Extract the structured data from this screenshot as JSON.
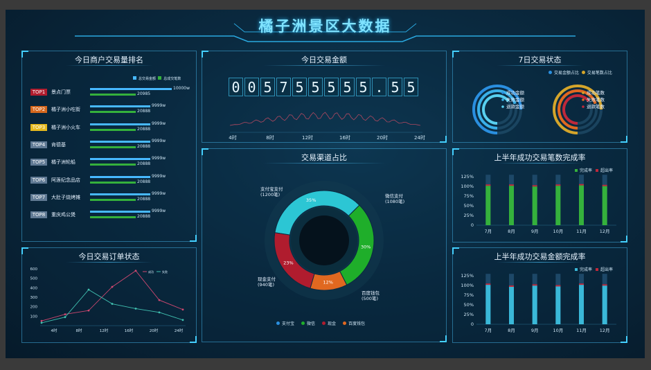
{
  "title": "橘子洲景区大数据",
  "colors": {
    "accent": "#44d0ff",
    "green": "#35b13c",
    "blue": "#47b9ff",
    "red": "#c0283a",
    "orange": "#e06820",
    "teal": "#2cc6d4"
  },
  "rank_panel": {
    "title": "今日商户交易量排名",
    "legend": [
      "总交易金额",
      "总成交笔数"
    ],
    "rows": [
      {
        "badge": "TOP1",
        "name": "景点门票",
        "v1": "10000w",
        "v2": "20985",
        "color": "#b01c2e",
        "f1": 1.0,
        "f2": 0.56
      },
      {
        "badge": "TOP2",
        "name": "橘子洲小吃街",
        "v1": "9999w",
        "v2": "20888",
        "color": "#d5671d",
        "f1": 0.74,
        "f2": 0.56
      },
      {
        "badge": "TOP3",
        "name": "橘子洲小火车",
        "v1": "9999w",
        "v2": "20888",
        "color": "#e6b91e",
        "f1": 0.74,
        "f2": 0.56
      },
      {
        "badge": "TOP4",
        "name": "肯德基",
        "v1": "9999w",
        "v2": "20888",
        "color": "#607a94",
        "f1": 0.74,
        "f2": 0.56
      },
      {
        "badge": "TOP5",
        "name": "橘子洲轮船",
        "v1": "9999w",
        "v2": "20888",
        "color": "#607a94",
        "f1": 0.74,
        "f2": 0.56
      },
      {
        "badge": "TOP6",
        "name": "阿莲纪念品店",
        "v1": "9999w",
        "v2": "20888",
        "color": "#607a94",
        "f1": 0.74,
        "f2": 0.56
      },
      {
        "badge": "TOP7",
        "name": "大肚子烧烤摊",
        "v1": "9999w",
        "v2": "20888",
        "color": "#607a94",
        "f1": 0.74,
        "f2": 0.56
      },
      {
        "badge": "TOP8",
        "name": "重庆鸡公煲",
        "v1": "9999w",
        "v2": "20888",
        "color": "#607a94",
        "f1": 0.74,
        "f2": 0.56
      }
    ]
  },
  "amount_panel": {
    "title": "今日交易金额",
    "digits": [
      "0",
      "0",
      "5",
      "7",
      "5",
      "5",
      "5",
      "5",
      "5",
      ".",
      "5",
      "5"
    ],
    "xticks": [
      "4时",
      "8时",
      "12时",
      "16时",
      "20时",
      "24时"
    ]
  },
  "status7_panel": {
    "title": "7日交易状态",
    "legend": [
      "交易金额占比",
      "交易笔数占比"
    ],
    "ring1_labels": [
      "成功金额",
      "失败金额",
      "退款金额"
    ],
    "ring2_labels": [
      "成功笔数",
      "失败笔数",
      "退款笔数"
    ]
  },
  "order_panel": {
    "title": "今日交易订单状态",
    "legend": [
      "成功",
      "失败"
    ]
  },
  "channel_panel": {
    "title": "交易渠道占比",
    "slices": [
      {
        "name": "支付宝",
        "pct": "35%",
        "label": "支付宝支付",
        "count": "(1200笔)",
        "color": "#2cc6d4",
        "value": 35
      },
      {
        "name": "微信",
        "pct": "30%",
        "label": "微信支付",
        "count": "(1080笔)",
        "color": "#1fae2a",
        "value": 30
      },
      {
        "name": "百度钱包",
        "pct": "12%",
        "label": "百度钱包",
        "count": "(500笔)",
        "color": "#e06820",
        "value": 12
      },
      {
        "name": "现金",
        "pct": "23%",
        "label": "现金支付",
        "count": "(940笔)",
        "color": "#b01c2e",
        "value": 23
      }
    ],
    "legend": [
      "支付宝",
      "微信",
      "现金",
      "百度钱包"
    ]
  },
  "count_rate_panel": {
    "title": "上半年成功交易笔数完成率",
    "legend": [
      "完成率",
      "超出率"
    ]
  },
  "amount_rate_panel": {
    "title": "上半年成功交易金额完成率",
    "legend": [
      "完成率",
      "超出率"
    ]
  },
  "chart_data": [
    {
      "type": "line",
      "title": "今日交易订单状态",
      "categories": [
        "4时",
        "8时",
        "12时",
        "16时",
        "20时",
        "24时"
      ],
      "series": [
        {
          "name": "成功",
          "values": [
            50,
            120,
            160,
            410,
            580,
            270,
            170
          ]
        },
        {
          "name": "失败",
          "values": [
            30,
            90,
            380,
            230,
            180,
            140,
            60
          ]
        }
      ],
      "ylim": [
        0,
        600
      ],
      "yticks": [
        "100",
        "200",
        "300",
        "400",
        "500",
        "600"
      ]
    },
    {
      "type": "bar",
      "title": "上半年成功交易笔数完成率",
      "categories": [
        "7月",
        "8月",
        "9月",
        "10月",
        "11月",
        "12月"
      ],
      "series": [
        {
          "name": "完成率",
          "values": [
            105,
            105,
            103,
            105,
            106,
            104
          ]
        },
        {
          "name": "超出率",
          "values": [
            130,
            130,
            130,
            130,
            130,
            130
          ]
        }
      ],
      "ylim": [
        0,
        125
      ],
      "yticks": [
        "0",
        "25%",
        "50%",
        "75%",
        "100%",
        "125%"
      ]
    },
    {
      "type": "bar",
      "title": "上半年成功交易金额完成率",
      "categories": [
        "7月",
        "8月",
        "9月",
        "10月",
        "11月",
        "12月"
      ],
      "series": [
        {
          "name": "完成率",
          "values": [
            105,
            100,
            103,
            101,
            105,
            103
          ]
        },
        {
          "name": "超出率",
          "values": [
            130,
            130,
            130,
            130,
            130,
            130
          ]
        }
      ],
      "ylim": [
        0,
        125
      ],
      "yticks": [
        "0",
        "25%",
        "50%",
        "75%",
        "100%",
        "125%"
      ]
    },
    {
      "type": "pie",
      "title": "交易渠道占比",
      "categories": [
        "支付宝",
        "微信",
        "百度钱包",
        "现金"
      ],
      "values": [
        35,
        30,
        12,
        23
      ]
    }
  ]
}
